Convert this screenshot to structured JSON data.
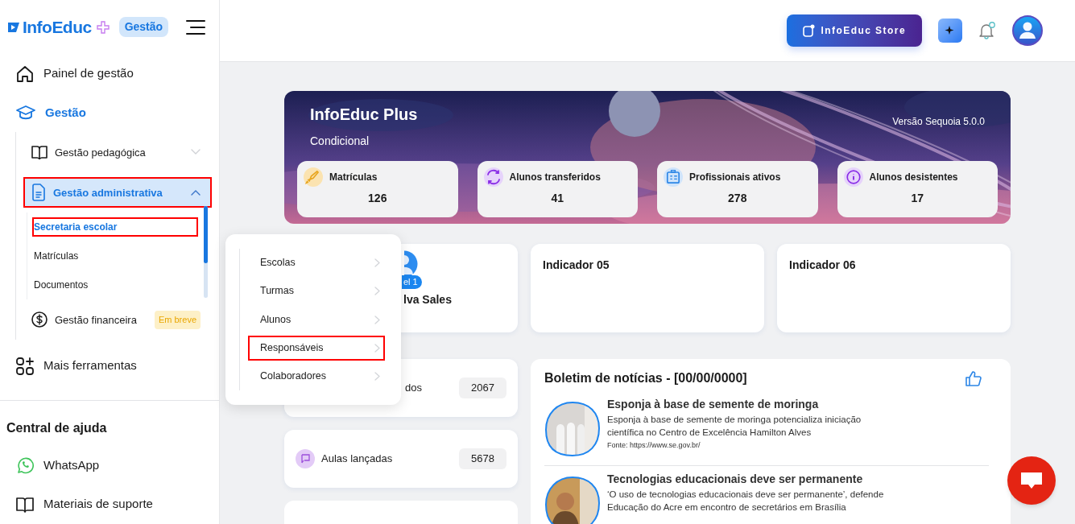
{
  "header": {
    "logo": "InfoEduc",
    "logo_badge": "Gestão",
    "store_button": "InfoEduc Store"
  },
  "sidebar": {
    "nav": [
      {
        "label": "Painel de gestão",
        "selected": false
      },
      {
        "label": "Gestão",
        "selected": true,
        "expanded": true,
        "children": [
          {
            "label": "Gestão pedagógica",
            "selected": false,
            "expanded": false,
            "highlighted": false
          },
          {
            "label": "Gestão administrativa",
            "selected": true,
            "expanded": true,
            "highlighted": true,
            "children": [
              {
                "label": "Secretaria escolar",
                "selected": true,
                "highlighted": true
              },
              {
                "label": "Matrículas",
                "selected": false,
                "highlighted": false
              },
              {
                "label": "Documentos",
                "selected": false,
                "highlighted": false
              }
            ]
          },
          {
            "label": "Gestão financeira",
            "selected": false,
            "highlighted": false,
            "badge": "Em breve"
          }
        ]
      },
      {
        "label": "Mais ferramentas",
        "selected": false
      }
    ],
    "help": {
      "title": "Central de ajuda",
      "items": [
        "WhatsApp",
        "Materiais de suporte"
      ]
    }
  },
  "banner": {
    "title": "InfoEduc Plus",
    "subtitle": "Condicional",
    "version": "Versão Sequoia 5.0.0",
    "stats": [
      {
        "label": "Matrículas",
        "value": "126",
        "color": "#fbe3b0"
      },
      {
        "label": "Alunos transferidos",
        "value": "41",
        "color": "#e6d3fb"
      },
      {
        "label": "Profissionais ativos",
        "value": "278",
        "color": "#cfe4fb"
      },
      {
        "label": "Alunos desistentes",
        "value": "17",
        "color": "#e6d3fb"
      }
    ]
  },
  "profile_card": {
    "badge": "el 1",
    "name": "lva Sales"
  },
  "indicators": [
    "Indicador 05",
    "Indicador 06"
  ],
  "counts": [
    {
      "label": "dos",
      "value": "2067"
    },
    {
      "label": "Aulas lançadas",
      "value": "5678"
    }
  ],
  "news": {
    "title": "Boletim de notícias - [00/00/0000]",
    "items": [
      {
        "headline": "Esponja à base de semente de moringa",
        "summary": "Esponja à base de semente de moringa potencializa iniciação científica no Centro de Excelência Hamilton Alves",
        "source": "Fonte: https://www.se.gov.br/"
      },
      {
        "headline": "Tecnologias educacionais deve ser permanente",
        "summary": "‘O uso de tecnologias educacionais deve ser permanente’, defende Educação do Acre em encontro de secretários em Brasília"
      }
    ]
  },
  "flyout": {
    "items": [
      {
        "label": "Escolas",
        "highlighted": false
      },
      {
        "label": "Turmas",
        "highlighted": false
      },
      {
        "label": "Alunos",
        "highlighted": false
      },
      {
        "label": "Responsáveis",
        "highlighted": true
      },
      {
        "label": "Colaboradores",
        "highlighted": false
      }
    ]
  }
}
